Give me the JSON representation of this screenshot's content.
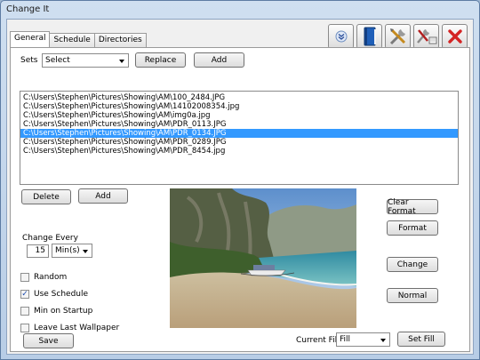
{
  "window": {
    "title": "Change It"
  },
  "toolbar": {
    "buttons": [
      {
        "icon": "scroll-down-icon"
      },
      {
        "icon": "book-icon"
      },
      {
        "icon": "tools-icon"
      },
      {
        "icon": "wrench-screwdriver-icon"
      },
      {
        "icon": "close-icon"
      }
    ]
  },
  "tabs": [
    "General",
    "Schedule",
    "Directories"
  ],
  "sets": {
    "label": "Sets",
    "value": "Select",
    "replace_label": "Replace",
    "add_label": "Add"
  },
  "files": [
    "C:\\Users\\Stephen\\Pictures\\Showing\\AM\\100_2484.JPG",
    "C:\\Users\\Stephen\\Pictures\\Showing\\AM\\14102008354.jpg",
    "C:\\Users\\Stephen\\Pictures\\Showing\\AM\\img0a.jpg",
    "C:\\Users\\Stephen\\Pictures\\Showing\\AM\\PDR_0113.JPG",
    "C:\\Users\\Stephen\\Pictures\\Showing\\AM\\PDR_0134.JPG",
    "C:\\Users\\Stephen\\Pictures\\Showing\\AM\\PDR_0289.JPG",
    "C:\\Users\\Stephen\\Pictures\\Showing\\AM\\PDR_8454.jpg"
  ],
  "selected_index": 4,
  "list_actions": {
    "delete_label": "Delete",
    "add_label": "Add"
  },
  "change_every": {
    "label": "Change Every",
    "value": "15",
    "unit": "Min(s)"
  },
  "options": {
    "random": {
      "label": "Random",
      "checked": false
    },
    "use_schedule": {
      "label": "Use Schedule",
      "checked": true
    },
    "min_on_startup": {
      "label": "Min on Startup",
      "checked": false
    },
    "leave_last_wallpaper": {
      "label": "Leave Last Wallpaper",
      "checked": false
    }
  },
  "format_buttons": {
    "clear_format": "Clear Format",
    "format": "Format",
    "change": "Change",
    "normal": "Normal"
  },
  "footer": {
    "save_label": "Save",
    "current_fill_label": "Current Fill",
    "fill_value": "Fill",
    "set_fill_label": "Set Fill"
  }
}
